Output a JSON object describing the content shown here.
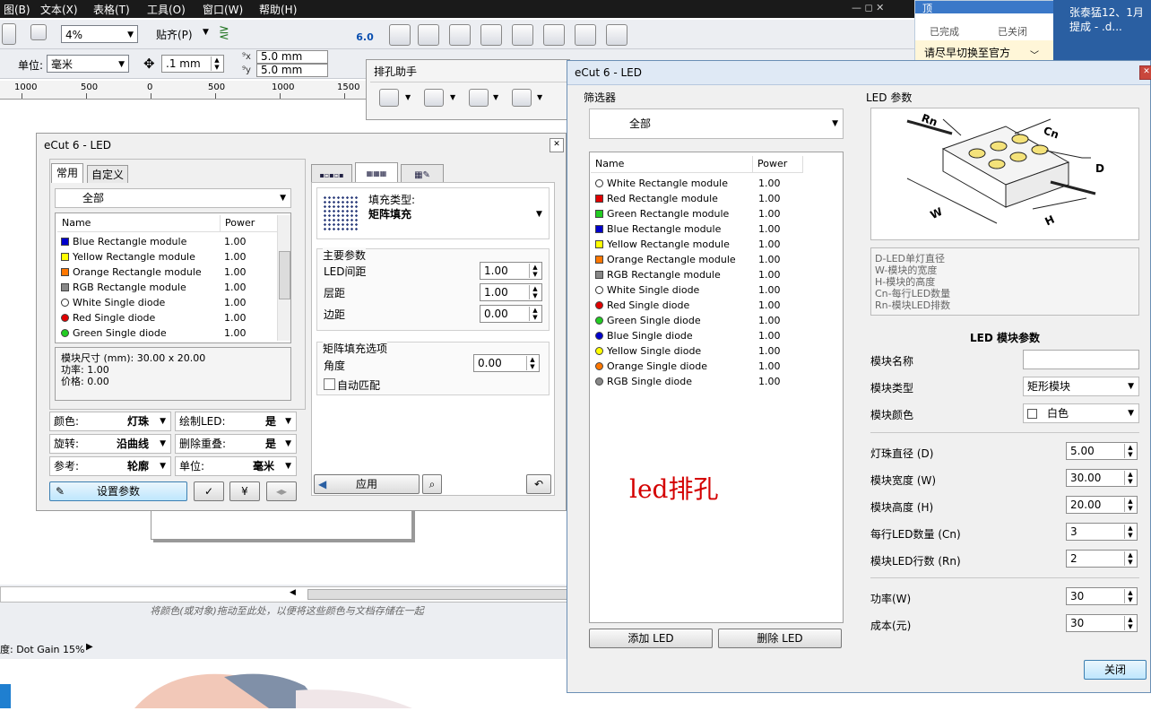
{
  "menubar": {
    "items": [
      "图(B)",
      "文本(X)",
      "表格(T)",
      "工具(O)",
      "窗口(W)",
      "帮助(H)"
    ],
    "window_controls": "— ◻ ✕"
  },
  "toolbar1": {
    "zoom": "4%",
    "snap_label": "贴齐(P)",
    "ecut_badge": "6.0"
  },
  "toolbar2": {
    "unit_label": "单位:",
    "unit_value": "毫米",
    "nudge": ".1 mm",
    "dup_x": "5.0 mm",
    "dup_y": "5.0 mm"
  },
  "ruler": {
    "labels": [
      "1000",
      "500",
      "0",
      "500",
      "1000",
      "1500"
    ]
  },
  "paikong_toolbar": {
    "title": "排孔助手"
  },
  "status": {
    "hint": "将颜色(或对象)拖动至此处，以便将这些颜色与文档存储在一起",
    "dot_gain": "度: Dot Gain 15%"
  },
  "notify": {
    "title": "顶",
    "done": "已完成",
    "closed": "已关闭",
    "message": "请尽早切换至官方",
    "side_text": "张泰猛12、1月提成 - .d..."
  },
  "colors": {
    "white": "#ffffff",
    "red": "#e00000",
    "green": "#22cc22",
    "blue": "#0000cc",
    "yellow": "#ffff00",
    "orange": "#ff7700",
    "gray": "#888888",
    "accent_text": "#d40000"
  },
  "small_dialog": {
    "title": "eCut 6 - LED",
    "tabs": [
      "常用",
      "自定义"
    ],
    "filter": "全部",
    "col_name": "Name",
    "col_power": "Power",
    "rows": [
      {
        "name": "Blue Rectangle module",
        "power": "1.00",
        "shape": "rect",
        "color": "#0000cc"
      },
      {
        "name": "Yellow Rectangle module",
        "power": "1.00",
        "shape": "rect",
        "color": "#ffff00"
      },
      {
        "name": "Orange Rectangle module",
        "power": "1.00",
        "shape": "rect",
        "color": "#ff7700"
      },
      {
        "name": "RGB Rectangle module",
        "power": "1.00",
        "shape": "rect",
        "color": "#888888"
      },
      {
        "name": "White Single diode",
        "power": "1.00",
        "shape": "circle",
        "color": "#ffffff"
      },
      {
        "name": "Red Single diode",
        "power": "1.00",
        "shape": "circle",
        "color": "#e00000"
      },
      {
        "name": "Green Single diode",
        "power": "1.00",
        "shape": "circle",
        "color": "#22cc22"
      }
    ],
    "info_size": "模块尺寸 (mm): 30.00 x 20.00",
    "info_power": "功率: 1.00",
    "info_price": "价格: 0.00",
    "opt_color_label": "颜色:",
    "opt_color_value": "灯珠",
    "opt_draw_label": "绘制LED:",
    "opt_draw_value": "是",
    "opt_rotate_label": "旋转:",
    "opt_rotate_value": "沿曲线",
    "opt_dedup_label": "删除重叠:",
    "opt_dedup_value": "是",
    "opt_ref_label": "参考:",
    "opt_ref_value": "轮廓",
    "opt_unit_label": "单位:",
    "opt_unit_value": "毫米",
    "setup_button": "设置参数",
    "fill_type_label": "填充类型:",
    "fill_type_value": "矩阵填充",
    "main_params": "主要参数",
    "led_spacing_label": "LED间距",
    "led_spacing": "1.00",
    "layer_spacing_label": "层距",
    "layer_spacing": "1.00",
    "margin_label": "边距",
    "margin": "0.00",
    "matrix_options": "矩阵填充选项",
    "angle_label": "角度",
    "angle": "0.00",
    "auto_match": "自动匹配",
    "apply_button": "应用"
  },
  "big_dialog": {
    "title": "eCut 6 - LED",
    "filter_label": "筛选器",
    "filter_value": "全部",
    "col_name": "Name",
    "col_power": "Power",
    "rows": [
      {
        "name": "White Rectangle module",
        "power": "1.00",
        "shape": "circle",
        "color": "#ffffff"
      },
      {
        "name": "Red Rectangle module",
        "power": "1.00",
        "shape": "rect",
        "color": "#e00000"
      },
      {
        "name": "Green Rectangle module",
        "power": "1.00",
        "shape": "rect",
        "color": "#22cc22"
      },
      {
        "name": "Blue Rectangle module",
        "power": "1.00",
        "shape": "rect",
        "color": "#0000cc"
      },
      {
        "name": "Yellow Rectangle module",
        "power": "1.00",
        "shape": "rect",
        "color": "#ffff00"
      },
      {
        "name": "Orange Rectangle module",
        "power": "1.00",
        "shape": "rect",
        "color": "#ff7700"
      },
      {
        "name": "RGB Rectangle module",
        "power": "1.00",
        "shape": "rect",
        "color": "#888888"
      },
      {
        "name": "White Single diode",
        "power": "1.00",
        "shape": "circle",
        "color": "#ffffff"
      },
      {
        "name": "Red Single diode",
        "power": "1.00",
        "shape": "circle",
        "color": "#e00000"
      },
      {
        "name": "Green Single diode",
        "power": "1.00",
        "shape": "circle",
        "color": "#22cc22"
      },
      {
        "name": "Blue Single diode",
        "power": "1.00",
        "shape": "circle",
        "color": "#0000cc"
      },
      {
        "name": "Yellow Single diode",
        "power": "1.00",
        "shape": "circle",
        "color": "#ffff00"
      },
      {
        "name": "Orange Single diode",
        "power": "1.00",
        "shape": "circle",
        "color": "#ff7700"
      },
      {
        "name": "RGB Single diode",
        "power": "1.00",
        "shape": "circle",
        "color": "#888888"
      }
    ],
    "overlay_text": "led排孔",
    "add_button": "添加 LED",
    "delete_button": "删除 LED",
    "led_params_label": "LED 参数",
    "diagram_labels": {
      "rn": "Rn",
      "cn": "Cn",
      "d": "D",
      "w": "W",
      "h": "H"
    },
    "legend_lines": [
      "D-LED单灯直径",
      "W-模块的宽度",
      "H-模块的高度",
      "Cn-每行LED数量",
      "Rn-模块LED排数"
    ],
    "module_params_title": "LED 模块参数",
    "name_label": "模块名称",
    "name_value": "",
    "type_label": "模块类型",
    "type_value": "矩形模块",
    "color_label": "模块颜色",
    "color_value": "白色",
    "diameter_label": "灯珠直径 (D)",
    "diameter": "5.00",
    "width_label": "模块宽度 (W)",
    "width": "30.00",
    "height_label": "模块高度 (H)",
    "height": "20.00",
    "per_row_label": "每行LED数量 (Cn)",
    "per_row": "3",
    "rows_label": "模块LED行数 (Rn)",
    "rows_count": "2",
    "power_label": "功率(W)",
    "power": "30",
    "cost_label": "成本(元)",
    "cost": "30",
    "close_button": "关闭"
  }
}
